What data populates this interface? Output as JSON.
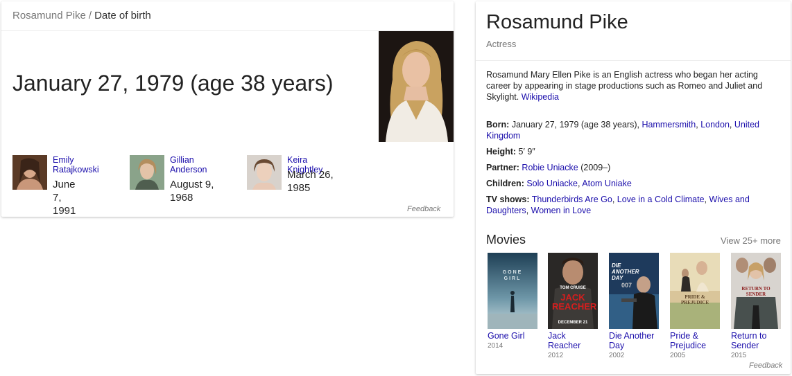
{
  "left_card": {
    "breadcrumb": {
      "parent": "Rosamund Pike",
      "separator": "/",
      "current": "Date of birth"
    },
    "answer": "January 27, 1979 (age 38 years)",
    "people": [
      {
        "name": "Emily Ratajkowski",
        "date": "June 7, 1991"
      },
      {
        "name": "Gillian Anderson",
        "date": "August 9, 1968"
      },
      {
        "name": "Keira Knightley",
        "date": "March 26, 1985"
      }
    ],
    "feedback": "Feedback"
  },
  "knowledge_panel": {
    "title": "Rosamund Pike",
    "subtitle": "Actress",
    "description": "Rosamund Mary Ellen Pike is an English actress who began her acting career by appearing in stage productions such as Romeo and Juliet and Skylight.",
    "description_link": "Wikipedia",
    "facts": {
      "born_label": "Born:",
      "born_value": "January 27, 1979 (age 38 years),",
      "born_link1": "Hammersmith",
      "born_link2": "London",
      "born_link3": "United Kingdom",
      "height_label": "Height:",
      "height_value": "5′ 9″",
      "partner_label": "Partner:",
      "partner_link": "Robie Uniacke",
      "partner_value": "(2009–)",
      "children_label": "Children:",
      "children_link1": "Solo Uniacke",
      "children_link2": "Atom Uniake",
      "tv_label": "TV shows:",
      "tv_link1": "Thunderbirds Are Go",
      "tv_link2": "Love in a Cold Climate",
      "tv_link3": "Wives and Daughters",
      "tv_link4": "Women in Love"
    },
    "movies_heading": "Movies",
    "view_more": "View 25+ more",
    "movies": [
      {
        "title": "Gone Girl",
        "year": "2014"
      },
      {
        "title": "Jack Reacher",
        "year": "2012"
      },
      {
        "title": "Die Another Day",
        "year": "2002"
      },
      {
        "title": "Pride & Prejudice",
        "year": "2005"
      },
      {
        "title": "Return to Sender",
        "year": "2015"
      }
    ],
    "poster_text": {
      "gone_girl": "GONE GIRL",
      "jack_reacher_top": "TOM CRUISE",
      "jack_reacher_title": "JACK REACHER",
      "jack_reacher_date": "DECEMBER 21",
      "die_another_day": "DIE ANOTHER DAY",
      "bond": "007",
      "pride": "PRIDE & PREJUDICE",
      "return": "RETURN TO SENDER"
    },
    "feedback": "Feedback"
  }
}
